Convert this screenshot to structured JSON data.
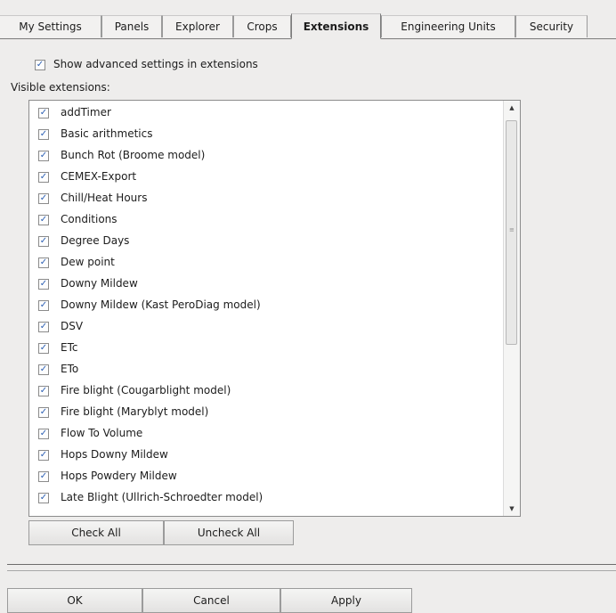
{
  "tabs": [
    {
      "label": "My Settings",
      "active": false
    },
    {
      "label": "Panels",
      "active": false
    },
    {
      "label": "Explorer",
      "active": false
    },
    {
      "label": "Crops",
      "active": false
    },
    {
      "label": "Extensions",
      "active": true
    },
    {
      "label": "Engineering Units",
      "active": false
    },
    {
      "label": "Security",
      "active": false
    }
  ],
  "advanced": {
    "label": "Show advanced settings in extensions",
    "checked": true
  },
  "visible_label": "Visible extensions:",
  "extensions": [
    {
      "label": "addTimer",
      "checked": true
    },
    {
      "label": "Basic arithmetics",
      "checked": true
    },
    {
      "label": "Bunch Rot (Broome model)",
      "checked": true
    },
    {
      "label": "CEMEX-Export",
      "checked": true
    },
    {
      "label": "Chill/Heat Hours",
      "checked": true
    },
    {
      "label": "Conditions",
      "checked": true
    },
    {
      "label": "Degree Days",
      "checked": true
    },
    {
      "label": "Dew point",
      "checked": true
    },
    {
      "label": "Downy Mildew",
      "checked": true
    },
    {
      "label": "Downy Mildew (Kast PeroDiag model)",
      "checked": true
    },
    {
      "label": "DSV",
      "checked": true
    },
    {
      "label": "ETc",
      "checked": true
    },
    {
      "label": "ETo",
      "checked": true
    },
    {
      "label": "Fire blight (Cougarblight model)",
      "checked": true
    },
    {
      "label": "Fire blight (Maryblyt model)",
      "checked": true
    },
    {
      "label": "Flow To Volume",
      "checked": true
    },
    {
      "label": "Hops Downy Mildew",
      "checked": true
    },
    {
      "label": "Hops Powdery Mildew",
      "checked": true
    },
    {
      "label": "Late Blight (Ullrich-Schroedter model)",
      "checked": true
    }
  ],
  "buttons": {
    "check_all": "Check All",
    "uncheck_all": "Uncheck All"
  },
  "footer": {
    "ok": "OK",
    "cancel": "Cancel",
    "apply": "Apply"
  },
  "icons": {
    "checkbox_checked": "checkmark-icon",
    "scroll_up": "up-arrow-icon",
    "scroll_down": "down-arrow-icon"
  },
  "colors": {
    "background": "#eeedec",
    "check_mark": "#2b5fb4"
  }
}
